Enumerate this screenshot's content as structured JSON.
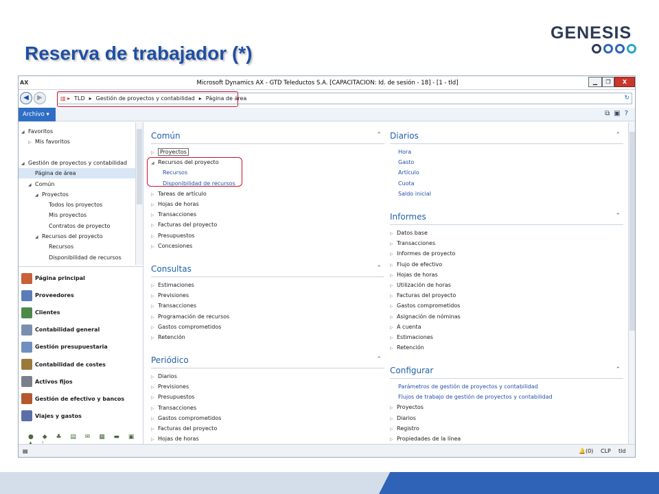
{
  "slide": {
    "title": "Reserva de trabajador (*)",
    "logo_text": "GENESIS",
    "logo_ring_colors": [
      "#2d3a55",
      "#2f63b7",
      "#2f63b7",
      "#27a7c9"
    ]
  },
  "window": {
    "app_icon": "AX",
    "title": "Microsoft Dynamics AX - GTD Teleductos S.A. [CAPACITACION: Id. de sesión - 18] - [1 - tld]",
    "min_label": "▁",
    "max_label": "❐",
    "close_label": "X"
  },
  "address": {
    "crumbs": [
      "TLD",
      "Gestión de proyectos y contabilidad",
      "Página de área"
    ]
  },
  "menu": {
    "archivo_label": "Archivo ▾"
  },
  "nav": {
    "tree": [
      {
        "label": "Favoritos",
        "indent": 0,
        "tri": "◢"
      },
      {
        "label": "Mis favoritos",
        "indent": 1,
        "tri": "▷"
      },
      {
        "label": "",
        "indent": 0,
        "tri": ""
      },
      {
        "label": "Gestión de proyectos y contabilidad",
        "indent": 0,
        "tri": "◢"
      },
      {
        "label": "Página de área",
        "indent": 1,
        "tri": "",
        "selected": true
      },
      {
        "label": "Común",
        "indent": 1,
        "tri": "◢"
      },
      {
        "label": "Proyectos",
        "indent": 2,
        "tri": "◢"
      },
      {
        "label": "Todos los proyectos",
        "indent": 3,
        "tri": ""
      },
      {
        "label": "Mis proyectos",
        "indent": 3,
        "tri": ""
      },
      {
        "label": "Contratos de proyecto",
        "indent": 3,
        "tri": ""
      },
      {
        "label": "Recursos del proyecto",
        "indent": 2,
        "tri": "◢"
      },
      {
        "label": "Recursos",
        "indent": 3,
        "tri": ""
      },
      {
        "label": "Disponibilidad de recursos",
        "indent": 3,
        "tri": ""
      }
    ],
    "modules": [
      {
        "label": "Página principal",
        "color": "#c8603a"
      },
      {
        "label": "Proveedores",
        "color": "#5a7db8"
      },
      {
        "label": "Clientes",
        "color": "#4d8a4a"
      },
      {
        "label": "Contabilidad general",
        "color": "#7a8fb0"
      },
      {
        "label": "Gestión presupuestaria",
        "color": "#6f8fbf"
      },
      {
        "label": "Contabilidad de costes",
        "color": "#9a7a3a"
      },
      {
        "label": "Activos fijos",
        "color": "#7a7f8a"
      },
      {
        "label": "Gestión de efectivo y bancos",
        "color": "#b5582f"
      },
      {
        "label": "Viajes y gastos",
        "color": "#5a6fa8"
      }
    ],
    "module_icons": "● ◆ ♣ ▤ ✉ ▦ ▬ ▣ ▲ ⁝"
  },
  "sections": {
    "comun": {
      "title": "Común",
      "items": [
        {
          "label": "Proyectos",
          "tri": "▷",
          "boxed": true
        },
        {
          "label": "Recursos del proyecto",
          "tri": "◢"
        },
        {
          "label": "Recursos",
          "tri": "",
          "blue": true,
          "indent": true
        },
        {
          "label": "Disponibilidad de recursos",
          "tri": "",
          "blue": true,
          "indent": true
        },
        {
          "label": "Tareas de artículo",
          "tri": "▷"
        },
        {
          "label": "Hojas de horas",
          "tri": "▷"
        },
        {
          "label": "Transacciones",
          "tri": "▷"
        },
        {
          "label": "Facturas del proyecto",
          "tri": "▷"
        },
        {
          "label": "Presupuestos",
          "tri": "▷"
        },
        {
          "label": "Concesiones",
          "tri": "▷"
        }
      ]
    },
    "consultas": {
      "title": "Consultas",
      "items": [
        {
          "label": "Estimaciones",
          "tri": "▷"
        },
        {
          "label": "Previsiones",
          "tri": "▷"
        },
        {
          "label": "Transacciones",
          "tri": "▷"
        },
        {
          "label": "Programación de recursos",
          "tri": "▷"
        },
        {
          "label": "Gastos comprometidos",
          "tri": "▷"
        },
        {
          "label": "Retención",
          "tri": "▷"
        }
      ]
    },
    "periodico": {
      "title": "Periódico",
      "items": [
        {
          "label": "Diarios",
          "tri": "▷"
        },
        {
          "label": "Previsiones",
          "tri": "▷"
        },
        {
          "label": "Presupuestos",
          "tri": "▷"
        },
        {
          "label": "Transacciones",
          "tri": "▷"
        },
        {
          "label": "Gastos comprometidos",
          "tri": "▷"
        },
        {
          "label": "Facturas del proyecto",
          "tri": "▷"
        },
        {
          "label": "Hojas de horas",
          "tri": "▷"
        }
      ]
    },
    "diarios": {
      "title": "Diarios",
      "items": [
        {
          "label": "Hora",
          "tri": "",
          "blue": true
        },
        {
          "label": "Gasto",
          "tri": "",
          "blue": true
        },
        {
          "label": "Artículo",
          "tri": "",
          "blue": true
        },
        {
          "label": "Cuota",
          "tri": "",
          "blue": true
        },
        {
          "label": "Saldo inicial",
          "tri": "",
          "blue": true
        }
      ]
    },
    "informes": {
      "title": "Informes",
      "items": [
        {
          "label": "Datos base",
          "tri": "▷"
        },
        {
          "label": "Transacciones",
          "tri": "▷"
        },
        {
          "label": "Informes de proyecto",
          "tri": "▷"
        },
        {
          "label": "Flujo de efectivo",
          "tri": "▷"
        },
        {
          "label": "Hojas de horas",
          "tri": "▷"
        },
        {
          "label": "Utilización de horas",
          "tri": "▷"
        },
        {
          "label": "Facturas del proyecto",
          "tri": "▷"
        },
        {
          "label": "Gastos comprometidos",
          "tri": "▷"
        },
        {
          "label": "Asignación de nóminas",
          "tri": "▷"
        },
        {
          "label": "A cuenta",
          "tri": "▷"
        },
        {
          "label": "Estimaciones",
          "tri": "▷"
        },
        {
          "label": "Retención",
          "tri": "▷"
        }
      ]
    },
    "configurar": {
      "title": "Configurar",
      "items": [
        {
          "label": "Parámetros de gestión de proyectos y contabilidad",
          "tri": "",
          "blue": true
        },
        {
          "label": "Flujos de trabajo de gestión de proyectos y contabilidad",
          "tri": "",
          "blue": true
        },
        {
          "label": "Proyectos",
          "tri": "▷"
        },
        {
          "label": "Diarios",
          "tri": "▷"
        },
        {
          "label": "Registro",
          "tri": "▷"
        },
        {
          "label": "Propiedades de la línea",
          "tri": "▷"
        }
      ]
    }
  },
  "status": {
    "notifications": "(0)",
    "currency": "CLP",
    "company": "tld"
  }
}
